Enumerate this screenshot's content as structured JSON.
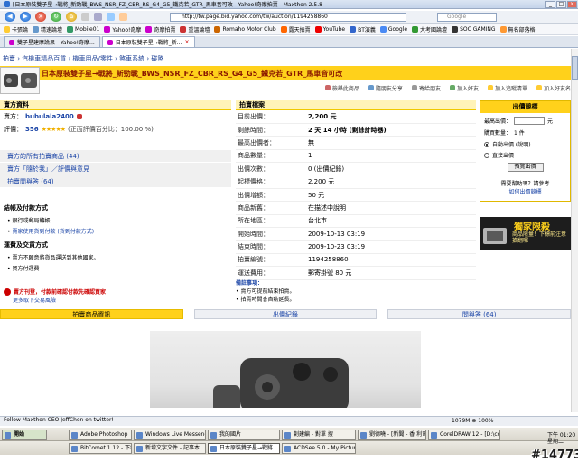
{
  "window": {
    "title": "[日本原裝雙子星→戰將_新勁戰_BWS_NSR_FZ_CBR_RS_G4_G5_鐵克若_GTR_馬車音可改 - Yahoo!奇摩拍賣 - Maxthon 2.5.8",
    "controls": [
      "_",
      "□",
      "×"
    ]
  },
  "menu": [
    "檔案",
    "編輯",
    "檢視",
    "我的最愛",
    "群組",
    "選項",
    "工具",
    "說明"
  ],
  "nav": {
    "address": "http://tw.page.bid.yahoo.com/tw/auction/1194258860",
    "search_placeholder": "Google"
  },
  "favorites": [
    "卡張論",
    "精速論壇",
    "Mobile01",
    "Yahoo!奇摩",
    "奇摩拍賣",
    "重溫論壇",
    "Romaho Motor Club",
    "露天拍賣",
    "YouTube",
    "BT演義",
    "Google",
    "大考國論壇",
    "SOC GAMING",
    "無名部落格"
  ],
  "tabs": [
    {
      "label": "雙子星建摩論果 - Yahoo!奇摩...",
      "active": false
    },
    {
      "label": "日本原裝雙子星→戰將_新...",
      "active": true
    }
  ],
  "breadcrumb": "拍賣 › 汽機車精品百貨 › 機車用品/零件 › 煞車系統 › 碟煞",
  "header": {
    "title": "日本原裝雙子星→戰將_新勁戰_BWS_NSR_FZ_CBR_RS_G4_G5_鐵克若_GTR_馬車音可改"
  },
  "actions": [
    "檢舉此商品",
    "隨朋友分享",
    "寄給朋友",
    "加入好友",
    "加入追蹤清單",
    "加入好友名單"
  ],
  "seller": {
    "heading": "賣方資料",
    "id_label": "賣方：",
    "id": "bubulala2400",
    "rating_label": "評價：",
    "rating": "356",
    "stars": "★★★★★",
    "rating_note": "(正面評價百分比：100.00 %)"
  },
  "seller_links": [
    "賣方的所有拍賣商品 (44)",
    "賣方「隨於我」／評價與意見",
    "拍賣問與答 (64)"
  ],
  "payment": {
    "heading": "結帳及付款方式",
    "items": [
      "銀行或郵局轉帳",
      "賣家使用貨到付款 (貨到付款方式)"
    ],
    "ship_heading": "運費及交貨方式",
    "ship_items": [
      "賣方不願意將貨品運送到其他國家。",
      "買方付運費"
    ]
  },
  "warning": {
    "text": "賣方刊登，付款前確認付款先確認買家！",
    "link": "更多取下交易風險"
  },
  "auction": {
    "heading": "拍賣檔案",
    "rows": [
      {
        "k": "目前出價：",
        "v": "2,200 元",
        "bold": true
      },
      {
        "k": "剩餘時間：",
        "v": "2 天 14 小時 (剩餘計時器)",
        "bold": true
      },
      {
        "k": "最高出價者：",
        "v": "無",
        "bold": false
      },
      {
        "k": "商品數量：",
        "v": "1",
        "bold": false
      },
      {
        "k": "出價次數：",
        "v": "0 (出價紀錄)",
        "bold": false
      },
      {
        "k": "起標價格：",
        "v": "2,200 元",
        "bold": false
      },
      {
        "k": "出價增額：",
        "v": "50 元",
        "bold": false
      },
      {
        "k": "商品新舊：",
        "v": "在描述中說明",
        "bold": false
      },
      {
        "k": "所在地區：",
        "v": "台北市",
        "bold": false
      },
      {
        "k": "開始時間：",
        "v": "2009-10-13 03:19",
        "bold": false
      },
      {
        "k": "結束時間：",
        "v": "2009-10-23 03:19",
        "bold": false
      },
      {
        "k": "拍賣編號：",
        "v": "1194258860",
        "bold": false
      },
      {
        "k": "運送費用：",
        "v": "郵寄掛號 80 元",
        "bold": false
      }
    ]
  },
  "notes": {
    "heading": "備註事項：",
    "items": [
      "賣方可提前結束拍賣。",
      "拍賣時間會自動延長。"
    ]
  },
  "bid": {
    "heading": "出價競標",
    "price_label": "最高出價：",
    "unit": "元",
    "qty_label": "購買數量：",
    "qty": "1 件",
    "opt_auto": "自動出價 (說明)",
    "opt_direct": "直接出價",
    "button": "預覽出價",
    "help": "需要幫助嗎？請參考",
    "help_link": "如何出價競標"
  },
  "promo": {
    "title": "獨家限殺",
    "sub": "商品限量！下標前注意搶翻囉"
  },
  "bottom_tabs": [
    "拍賣商品資訊",
    "出價紀錄",
    "問與答 (64)"
  ],
  "status": {
    "left": "Follow Maxthon CEO JeffChen on twitter!",
    "right": "1079M  ⊕  100%"
  },
  "task1": [
    "開始",
    "Adobe Photoshop",
    "Windows Live Messenger",
    "我的國片",
    "創建編 - 對單 搜",
    "劉德曉 - [新聞 - 香 利司]",
    "CorelDRAW 12 - [D:\\co..."
  ],
  "task2": [
    "BitComet 1.12 - 下載：2...",
    "新增文字文件 - 記事本",
    "日本原裝雙子星→戰將...",
    "ACDSee 5.0 - My Pictures"
  ],
  "clock": {
    "time": "下午 01:20",
    "day": "星期二"
  },
  "watermark": "#147739"
}
